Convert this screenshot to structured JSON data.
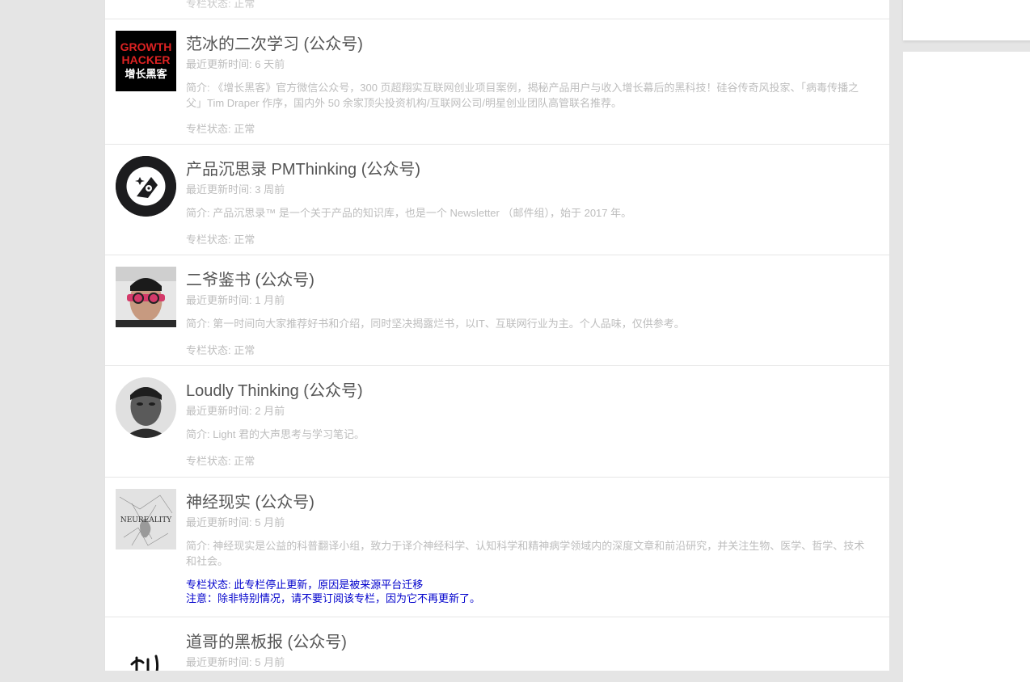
{
  "labels": {
    "updated_prefix": "最近更新时间: ",
    "intro_prefix": "简介: ",
    "status_prefix": "专栏状态: "
  },
  "top_item": {
    "status": "正常"
  },
  "items": [
    {
      "title": "范冰的二次学习 (公众号)",
      "updated": "6 天前",
      "intro": "《增长黑客》官方微信公众号，300 页超翔实互联网创业项目案例，揭秘产品用户与收入增长幕后的黑科技！硅谷传奇风投家、「病毒传播之父」Tim Draper 作序，国内外 50 余家顶尖投资机构/互联网公司/明星创业团队高管联名推荐。",
      "status": "正常",
      "logo_lines": [
        "GROWTH",
        "HACKER",
        "增长黑客"
      ]
    },
    {
      "title": "产品沉思录 PMThinking (公众号)",
      "updated": "3 周前",
      "intro": "产品沉思录™ 是一个关于产品的知识库，也是一个 Newsletter （邮件组），始于 2017 年。",
      "status": "正常"
    },
    {
      "title": "二爷鉴书 (公众号)",
      "updated": "1 月前",
      "intro": "第一时间向大家推荐好书和介绍，同时坚决揭露烂书，以IT、互联网行业为主。个人品味，仅供参考。",
      "status": "正常"
    },
    {
      "title": "Loudly Thinking (公众号)",
      "updated": "2 月前",
      "intro": "Light 君的大声思考与学习笔记。",
      "status": "正常"
    },
    {
      "title": "神经现实 (公众号)",
      "updated": "5 月前",
      "intro": "神经现实是公益的科普翻译小组，致力于译介神经科学、认知科学和精神病学领域内的深度文章和前沿研究，并关注生物、医学、哲学、技术和社会。",
      "status": "此专栏停止更新，原因是被来源平台迁移",
      "notice": "注意：除非特别情况，请不要订阅该专栏，因为它不再更新了。",
      "logo_text": "NEUREALITY"
    },
    {
      "title": "道哥的黑板报 (公众号)",
      "updated": "5 月前"
    }
  ],
  "colors": {
    "title": "#555555",
    "meta": "#bdbdbd",
    "notice_blue": "#0000cc",
    "page_bg": "#e5e5e5"
  }
}
